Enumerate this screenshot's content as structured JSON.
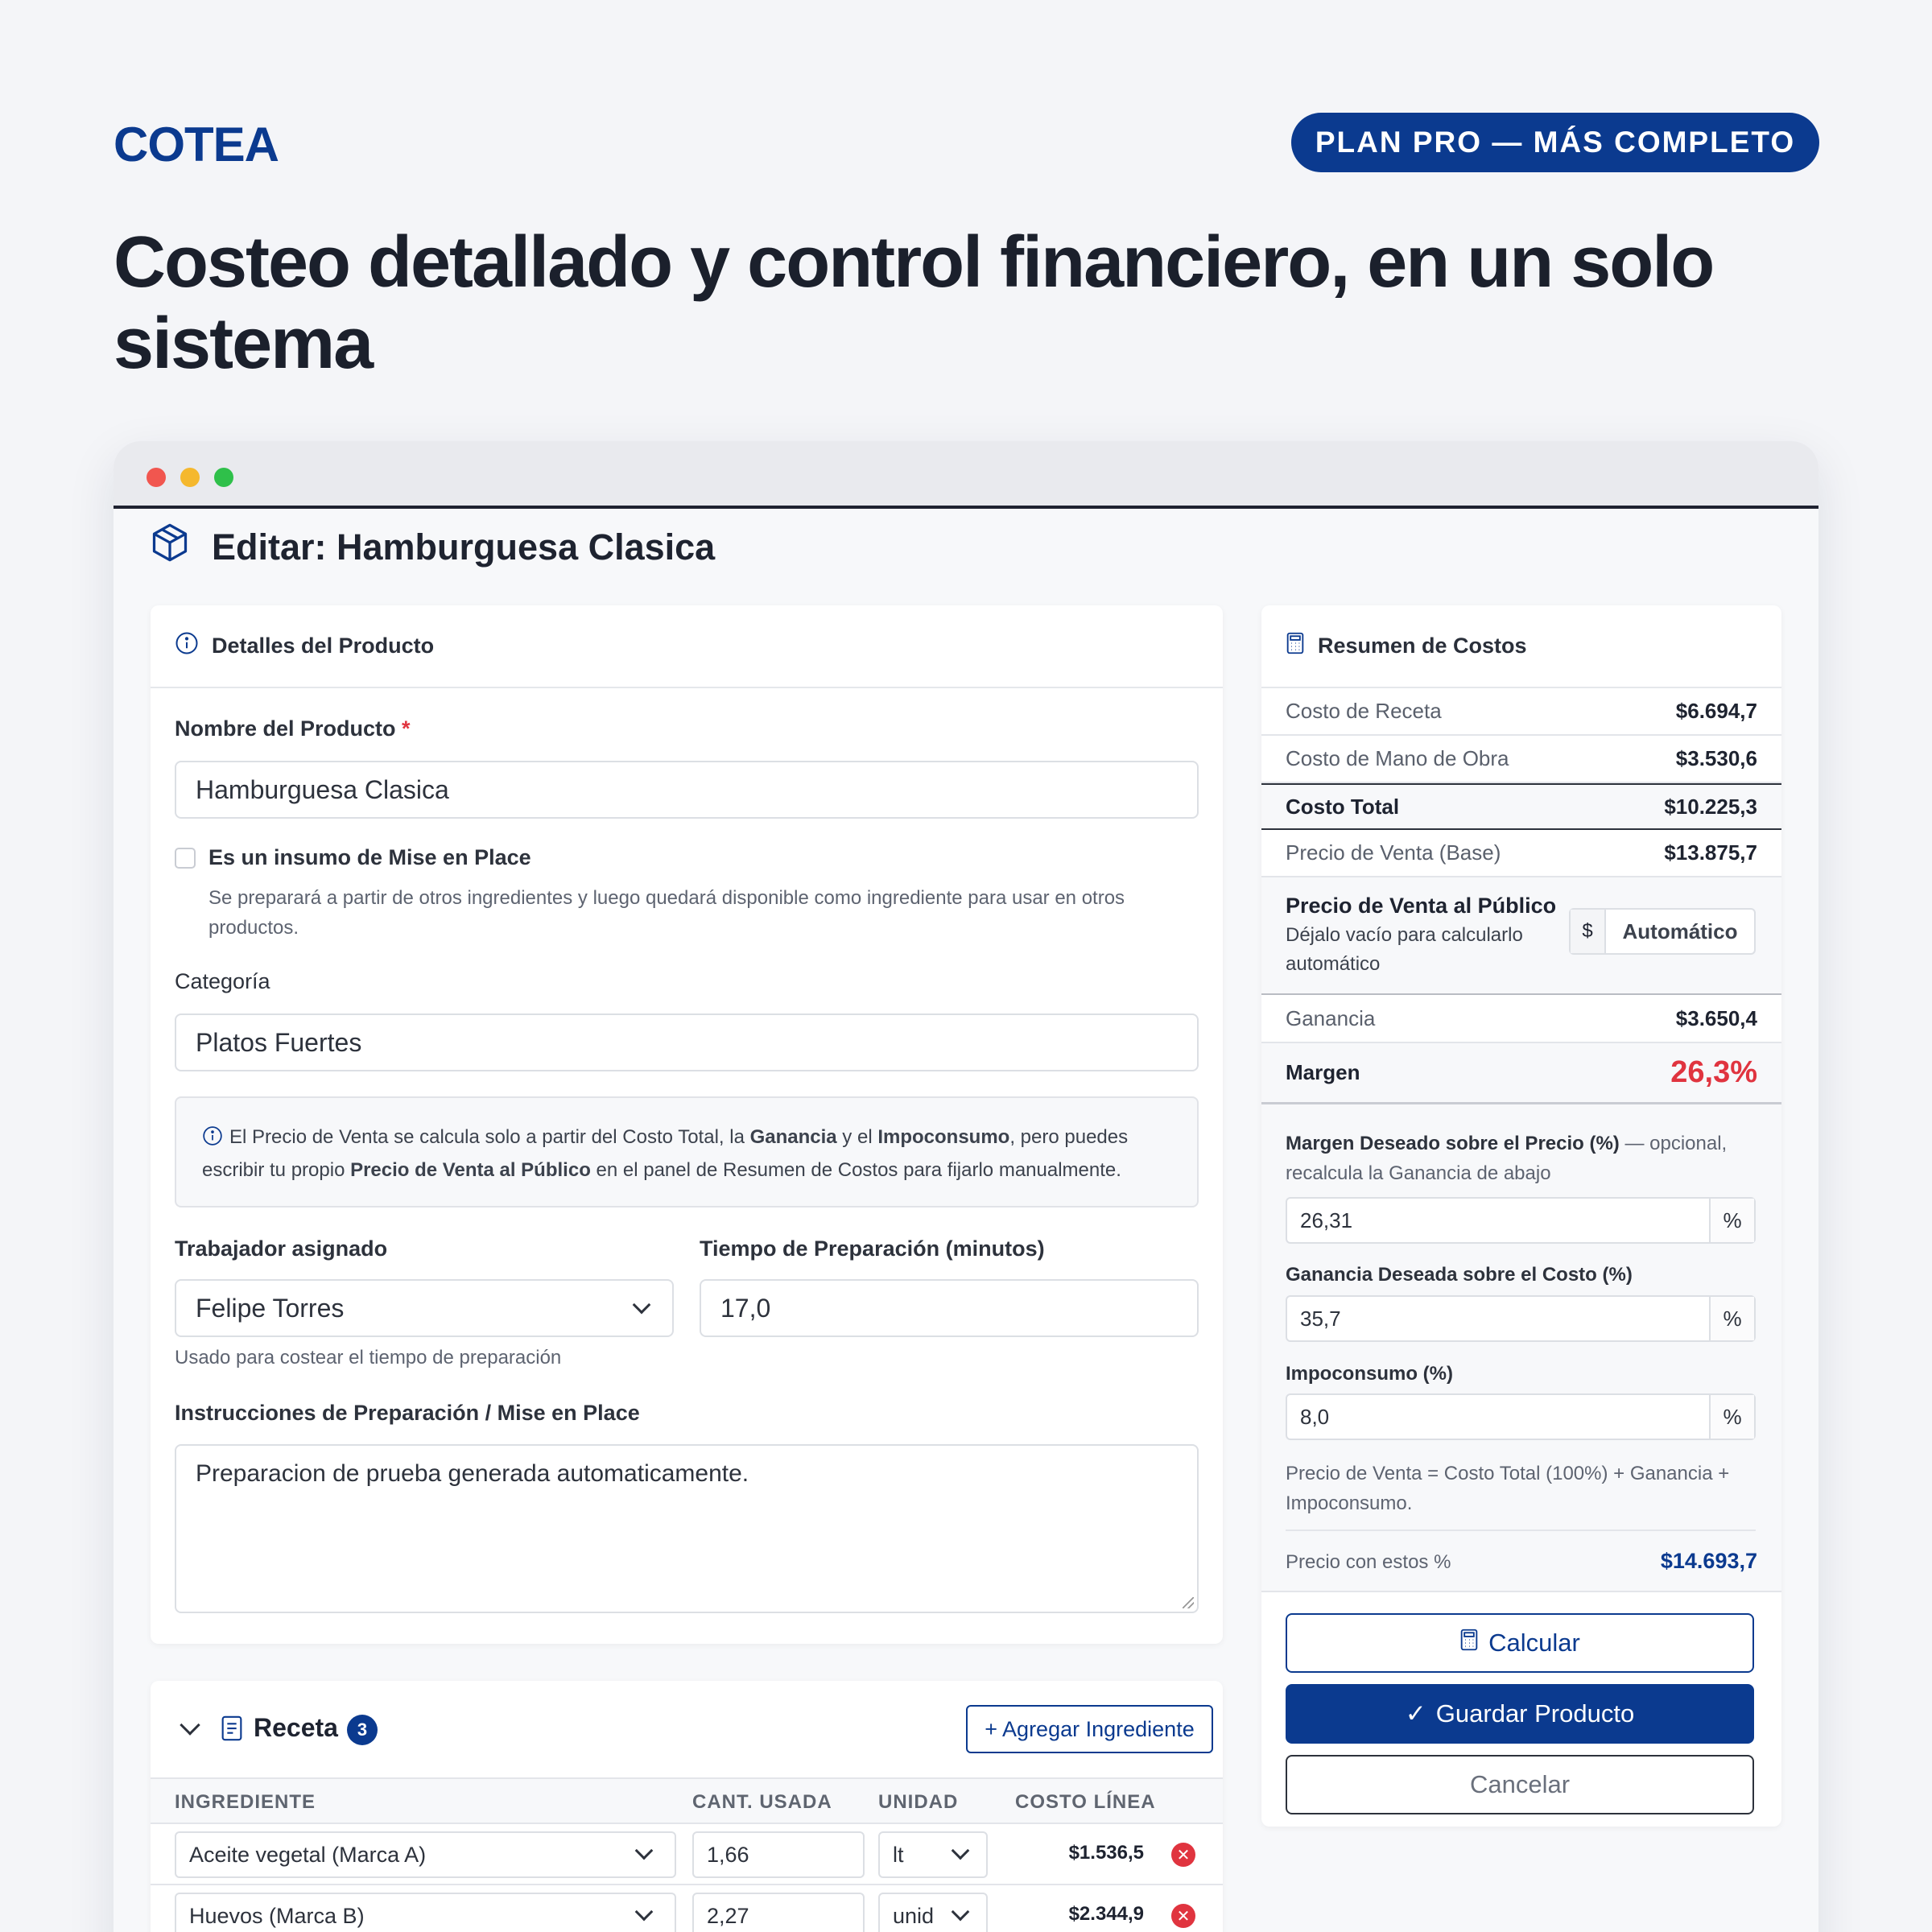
{
  "brand": "COTEA",
  "plan_badge": "PLAN PRO — MÁS COMPLETO",
  "headline": "Costeo detallado y control financiero, en un solo sistema",
  "colors": {
    "brand": "#0b3a8f",
    "danger": "#e0343f",
    "accent_blue": "#0b3a8f"
  },
  "page": {
    "title": "Editar: Hamburguesa Clasica",
    "title_icon": "box-icon"
  },
  "details": {
    "header": "Detalles del Producto",
    "name_label": "Nombre del Producto",
    "required_mark": "*",
    "name_value": "Hamburguesa Clasica",
    "mise_label": "Es un insumo de Mise en Place",
    "mise_checked": false,
    "mise_help": "Se preparará a partir de otros ingredientes y luego quedará disponible como ingrediente para usar en otros productos.",
    "category_label": "Categoría",
    "category_value": "Platos Fuertes",
    "info_parts": [
      "El Precio de Venta se calcula solo a partir del Costo Total, la ",
      "Ganancia",
      " y el ",
      "Impoconsumo",
      ", pero puedes escribir tu propio ",
      "Precio de Venta al Público",
      " en el panel de Resumen de Costos para fijarlo manualmente."
    ],
    "worker_label": "Trabajador asignado",
    "worker_value": "Felipe Torres",
    "worker_help": "Usado para costear el tiempo de preparación",
    "time_label": "Tiempo de Preparación (minutos)",
    "time_value": "17,0",
    "instructions_label": "Instrucciones de Preparación / Mise en Place",
    "instructions_value": "Preparacion de prueba generada automaticamente."
  },
  "recipe": {
    "title": "Receta",
    "count": "3",
    "add_button": "+ Agregar Ingrediente",
    "columns": [
      "INGREDIENTE",
      "CANT. USADA",
      "UNIDAD",
      "COSTO LÍNEA"
    ],
    "rows": [
      {
        "ingredient": "Aceite vegetal (Marca A)",
        "qty": "1,66",
        "unit": "lt",
        "cost": "$1.536,5"
      },
      {
        "ingredient": "Huevos (Marca B)",
        "qty": "2,27",
        "unit": "unid",
        "cost": "$2.344,9"
      }
    ]
  },
  "summary": {
    "header": "Resumen de Costos",
    "recipe_cost_label": "Costo de Receta",
    "recipe_cost": "$6.694,7",
    "labor_cost_label": "Costo de Mano de Obra",
    "labor_cost": "$3.530,6",
    "total_label": "Costo Total",
    "total": "$10.225,3",
    "base_price_label": "Precio de Venta (Base)",
    "base_price": "$13.875,7",
    "public_price_label": "Precio de Venta al Público",
    "public_price_help": "Déjalo vacío para calcularlo automático",
    "currency": "$",
    "public_price_placeholder": "Automático",
    "profit_label": "Ganancia",
    "profit": "$3.650,4",
    "margin_label": "Margen",
    "margin": "26,3%",
    "desired_margin_label": "Margen Deseado sobre el Precio (%)",
    "desired_margin_note": " — opcional, recalcula la Ganancia de abajo",
    "desired_margin_value": "26,31",
    "desired_profit_label": "Ganancia Deseada sobre el Costo (%)",
    "desired_profit_value": "35,7",
    "tax_label": "Impoconsumo (%)",
    "tax_value": "8,0",
    "percent": "%",
    "formula": "Precio de Venta = Costo Total (100%) + Ganancia + Impoconsumo.",
    "price_with_label": "Precio con estos %",
    "price_with_value": "$14.693,7"
  },
  "actions": {
    "calculate": "Calcular",
    "save": "Guardar Producto",
    "cancel": "Cancelar"
  }
}
